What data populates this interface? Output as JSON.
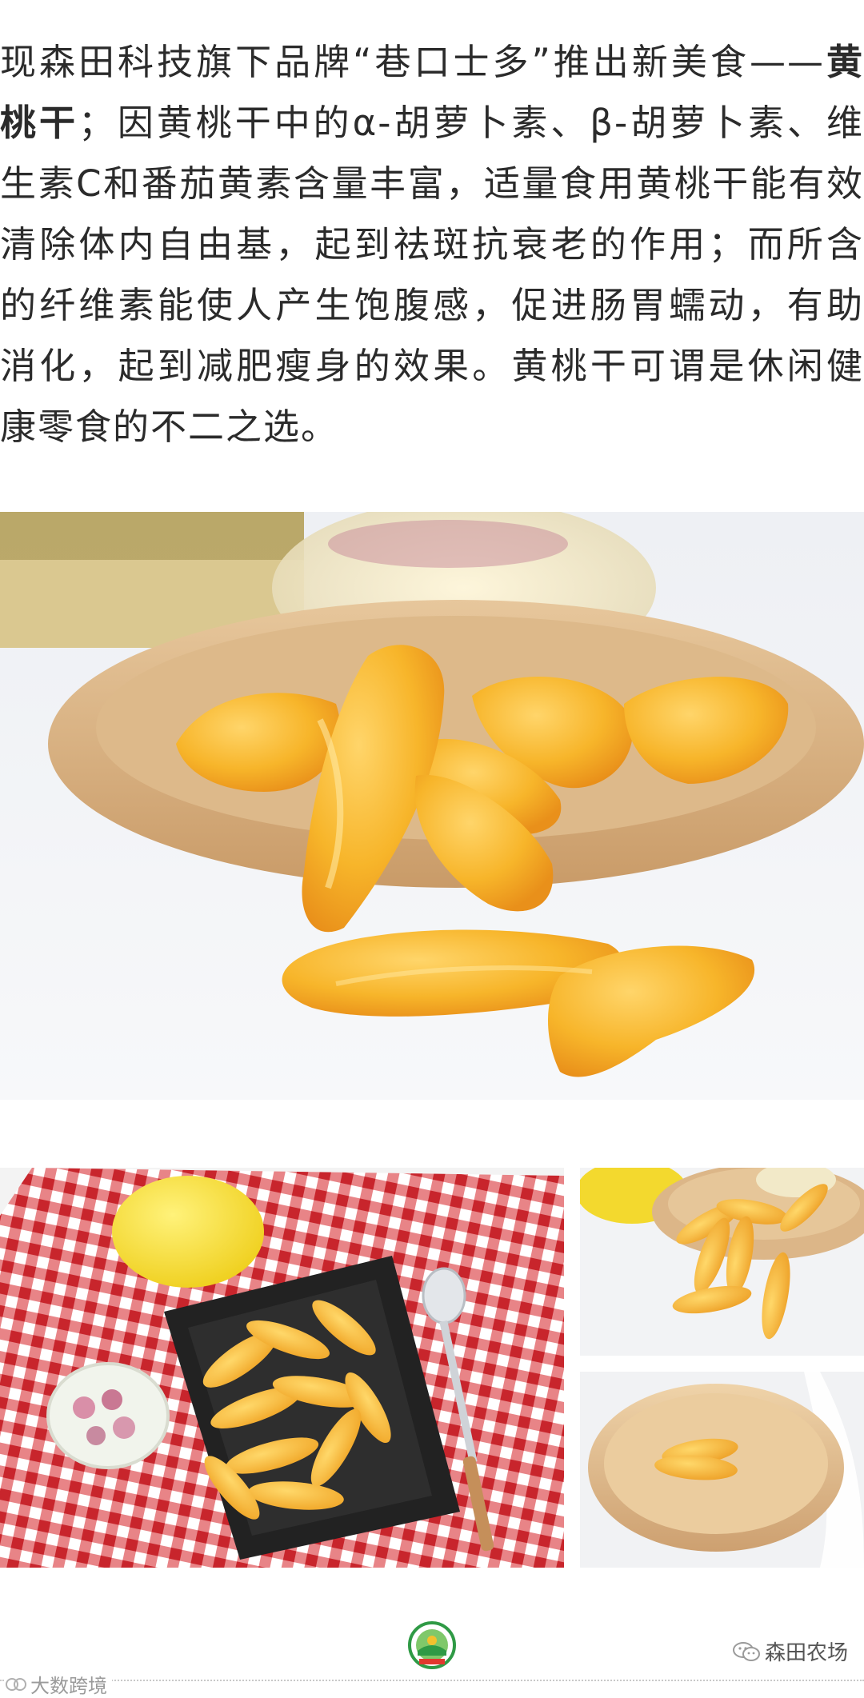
{
  "article": {
    "text_before": "现森田科技旗下品牌“巷口士多”推出新美食——",
    "highlight": "黄桃干",
    "text_after": "；因黄桃干中的α-胡萝卜素、β-胡萝卜素、维生素C和番茄黄素含量丰富，适量食用黄桃干能有效清除体内自由基，起到祛斑抗衰老的作用；而所含的纤维素能使人产生饱腹感，促进肠胃蠕动，有助消化，起到减肥瘦身的效果。黄桃干可谓是休闲健康零食的不二之选。"
  },
  "footer": {
    "brand_name": "森田农场",
    "watermark": "大数跨境"
  },
  "colors": {
    "text": "#2b2b2b",
    "peach": "#f6b22b",
    "wood": "#d9b58a",
    "check_red": "#d93a3f"
  },
  "icons": {
    "footer_logo": "farm-badge-icon",
    "brand": "wechat-icon",
    "watermark": "watermark-logo-icon"
  }
}
